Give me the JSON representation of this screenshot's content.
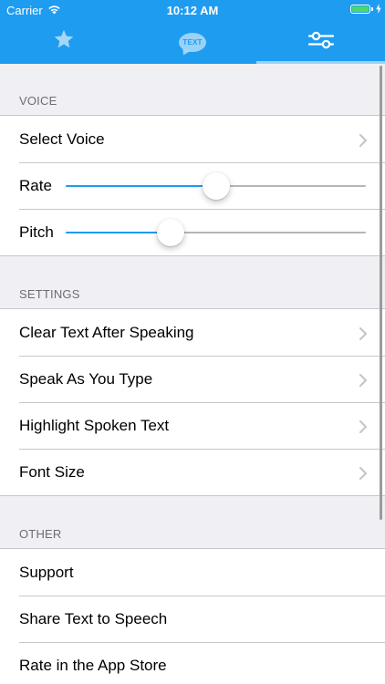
{
  "status_bar": {
    "carrier": "Carrier",
    "time": "10:12 AM"
  },
  "tabs": [
    {
      "name": "favorites",
      "icon": "star-icon",
      "selected": false
    },
    {
      "name": "text",
      "icon": "text-bubble-icon",
      "label": "TEXT",
      "selected": false
    },
    {
      "name": "settings",
      "icon": "sliders-icon",
      "selected": true
    }
  ],
  "colors": {
    "accent": "#1e9cf0",
    "background": "#efeff4",
    "separator": "#c8c7cc",
    "battery": "#4cd964"
  },
  "sections": {
    "voice": {
      "header": "VOICE",
      "select_voice": "Select Voice",
      "rate": {
        "label": "Rate",
        "value": 0.5
      },
      "pitch": {
        "label": "Pitch",
        "value": 0.35
      }
    },
    "settings": {
      "header": "SETTINGS",
      "items": [
        "Clear Text After Speaking",
        "Speak As You Type",
        "Highlight Spoken Text",
        "Font Size"
      ]
    },
    "other": {
      "header": "OTHER",
      "items": [
        "Support",
        "Share Text to Speech",
        "Rate in the App Store"
      ]
    }
  }
}
